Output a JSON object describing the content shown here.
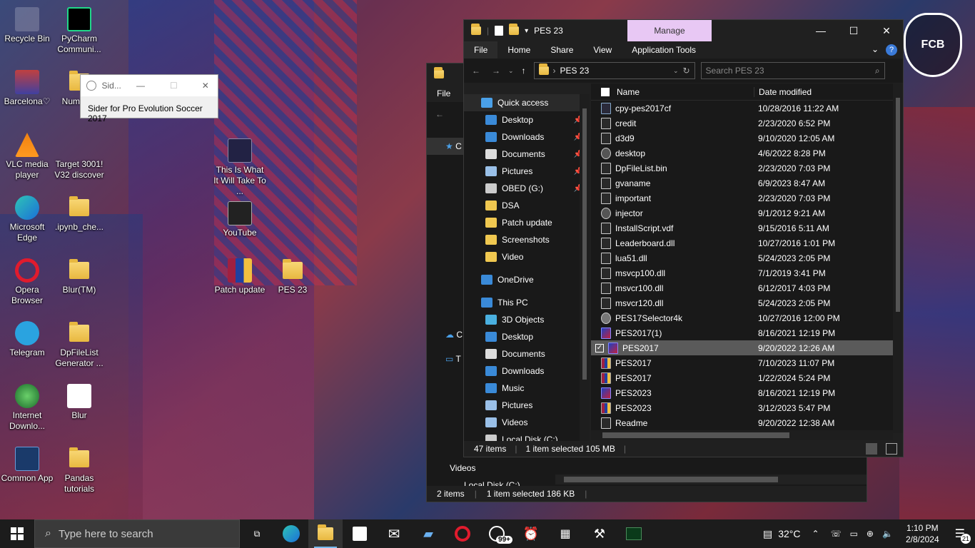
{
  "desktop": {
    "icons": [
      {
        "label": "Recycle Bin",
        "icon": "recycle-bin-icon"
      },
      {
        "label": "PyCharm Communi...",
        "icon": "pycharm-icon"
      },
      {
        "label": "Barcelona♡",
        "icon": "image-file-icon"
      },
      {
        "label": "Num tuto",
        "icon": "folder-icon"
      },
      {
        "label": "VLC media player",
        "icon": "vlc-icon"
      },
      {
        "label": "Target 3001! V32 discover",
        "icon": "target-icon"
      },
      {
        "label": "This Is What It Will Take To ...",
        "icon": "video-file-icon"
      },
      {
        "label": "Microsoft Edge",
        "icon": "edge-icon"
      },
      {
        "label": ".ipynb_che...",
        "icon": "folder-icon"
      },
      {
        "label": "YouTube",
        "icon": "youtube-icon"
      },
      {
        "label": "Opera Browser",
        "icon": "opera-icon"
      },
      {
        "label": "Blur(TM)",
        "icon": "folder-icon"
      },
      {
        "label": "Patch update",
        "icon": "archive-icon"
      },
      {
        "label": "PES 23",
        "icon": "folder-icon"
      },
      {
        "label": "Telegram",
        "icon": "telegram-icon"
      },
      {
        "label": "DpFileList Generator ...",
        "icon": "folder-icon"
      },
      {
        "label": "Internet Downlo...",
        "icon": "idm-icon"
      },
      {
        "label": "Blur",
        "icon": "blur-icon"
      },
      {
        "label": "Common App",
        "icon": "common-app-icon"
      },
      {
        "label": "Pandas tutorials",
        "icon": "folder-icon"
      }
    ]
  },
  "sider_window": {
    "title": "Sid...",
    "content": "Sider for Pro Evolution Soccer 2017"
  },
  "back_window": {
    "tab_file": "File",
    "status_items": "2 items",
    "status_selected": "1 item selected  186 KB",
    "nav_items": [
      {
        "label": "Videos"
      },
      {
        "label": "Local Disk (C:)"
      }
    ],
    "partial_labels": [
      "C",
      "C",
      "T"
    ]
  },
  "explorer": {
    "title": "PES 23",
    "manage_label": "Manage",
    "tabs": [
      "File",
      "Home",
      "Share",
      "View",
      "Application Tools"
    ],
    "address_path": "PES 23",
    "search_placeholder": "Search PES 23",
    "nav": [
      {
        "label": "Quick access",
        "icon": "star-icon",
        "pinned": false,
        "indent": 0
      },
      {
        "label": "Desktop",
        "icon": "desktop-icon",
        "pinned": true,
        "indent": 1
      },
      {
        "label": "Downloads",
        "icon": "download-icon",
        "pinned": true,
        "indent": 1
      },
      {
        "label": "Documents",
        "icon": "documents-icon",
        "pinned": true,
        "indent": 1
      },
      {
        "label": "Pictures",
        "icon": "pictures-icon",
        "pinned": true,
        "indent": 1
      },
      {
        "label": "OBED (G:)",
        "icon": "drive-icon",
        "pinned": true,
        "indent": 1
      },
      {
        "label": "DSA",
        "icon": "folder-icon",
        "pinned": false,
        "indent": 1
      },
      {
        "label": "Patch update",
        "icon": "folder-icon",
        "pinned": false,
        "indent": 1
      },
      {
        "label": "Screenshots",
        "icon": "folder-icon",
        "pinned": false,
        "indent": 1
      },
      {
        "label": "Video",
        "icon": "folder-icon",
        "pinned": false,
        "indent": 1
      },
      {
        "label": "OneDrive",
        "icon": "cloud-icon",
        "pinned": false,
        "indent": 0
      },
      {
        "label": "This PC",
        "icon": "pc-icon",
        "pinned": false,
        "indent": 0
      },
      {
        "label": "3D Objects",
        "icon": "cube-icon",
        "pinned": false,
        "indent": 1
      },
      {
        "label": "Desktop",
        "icon": "desktop-icon",
        "pinned": false,
        "indent": 1
      },
      {
        "label": "Documents",
        "icon": "documents-icon",
        "pinned": false,
        "indent": 1
      },
      {
        "label": "Downloads",
        "icon": "download-icon",
        "pinned": false,
        "indent": 1
      },
      {
        "label": "Music",
        "icon": "music-icon",
        "pinned": false,
        "indent": 1
      },
      {
        "label": "Pictures",
        "icon": "pictures-icon",
        "pinned": false,
        "indent": 1
      },
      {
        "label": "Videos",
        "icon": "videos-icon",
        "pinned": false,
        "indent": 1
      },
      {
        "label": "Local Disk (C:)",
        "icon": "drive-icon",
        "pinned": false,
        "indent": 1
      }
    ],
    "columns": {
      "name": "Name",
      "date": "Date modified"
    },
    "files": [
      {
        "name": "cpy-pes2017cf",
        "date": "10/28/2016 11:22 AM",
        "icon": "config-file-icon",
        "selected": false
      },
      {
        "name": "credit",
        "date": "2/23/2020 6:52 PM",
        "icon": "text-file-icon",
        "selected": false
      },
      {
        "name": "d3d9",
        "date": "9/10/2020 12:05 AM",
        "icon": "text-file-icon",
        "selected": false
      },
      {
        "name": "desktop",
        "date": "4/6/2022 8:28 PM",
        "icon": "settings-file-icon",
        "selected": false
      },
      {
        "name": "DpFileList.bin",
        "date": "2/23/2020 7:03 PM",
        "icon": "text-file-icon",
        "selected": false
      },
      {
        "name": "gvaname",
        "date": "6/9/2023 8:47 AM",
        "icon": "text-file-icon",
        "selected": false
      },
      {
        "name": "important",
        "date": "2/23/2020 7:03 PM",
        "icon": "text-file-icon",
        "selected": false
      },
      {
        "name": "injector",
        "date": "9/1/2012 9:21 AM",
        "icon": "settings-file-icon",
        "selected": false
      },
      {
        "name": "InstallScript.vdf",
        "date": "9/15/2016 5:11 AM",
        "icon": "text-file-icon",
        "selected": false
      },
      {
        "name": "Leaderboard.dll",
        "date": "10/27/2016 1:01 PM",
        "icon": "dll-file-icon",
        "selected": false
      },
      {
        "name": "lua51.dll",
        "date": "5/24/2023 2:05 PM",
        "icon": "dll-file-icon",
        "selected": false
      },
      {
        "name": "msvcp100.dll",
        "date": "7/1/2019 3:41 PM",
        "icon": "dll-file-icon",
        "selected": false
      },
      {
        "name": "msvcr100.dll",
        "date": "6/12/2017 4:03 PM",
        "icon": "dll-file-icon",
        "selected": false
      },
      {
        "name": "msvcr120.dll",
        "date": "5/24/2023 2:05 PM",
        "icon": "dll-file-icon",
        "selected": false
      },
      {
        "name": "PES17Selector4k",
        "date": "10/27/2016 12:00 PM",
        "icon": "app-gear-icon",
        "selected": false
      },
      {
        "name": "PES2017(1)",
        "date": "8/16/2021 12:19 PM",
        "icon": "pes-app-icon",
        "selected": false
      },
      {
        "name": "PES2017",
        "date": "9/20/2022 12:26 AM",
        "icon": "pes-app-icon",
        "selected": true
      },
      {
        "name": "PES2017",
        "date": "7/10/2023 11:07 PM",
        "icon": "archive-icon",
        "selected": false
      },
      {
        "name": "PES2017",
        "date": "1/22/2024 5:24 PM",
        "icon": "archive-icon",
        "selected": false
      },
      {
        "name": "PES2023",
        "date": "8/16/2021 12:19 PM",
        "icon": "pes-app-icon",
        "selected": false
      },
      {
        "name": "PES2023",
        "date": "3/12/2023 5:47 PM",
        "icon": "archive-icon",
        "selected": false
      },
      {
        "name": "Readme",
        "date": "9/20/2022 12:38 AM",
        "icon": "text-file-icon",
        "selected": false
      }
    ],
    "status_items": "47 items",
    "status_selected": "1 item selected  105 MB"
  },
  "taskbar": {
    "search_placeholder": "Type here to search",
    "whatsapp_badge": "99+",
    "temperature": "32°C",
    "time": "1:10 PM",
    "date": "2/8/2024",
    "notification_count": "21"
  },
  "colors": {
    "accent": "#76b9ed",
    "manage_tab_bg": "#e8c8f4",
    "selected_row": "#5a5a5a",
    "folder": "#f0c850"
  }
}
